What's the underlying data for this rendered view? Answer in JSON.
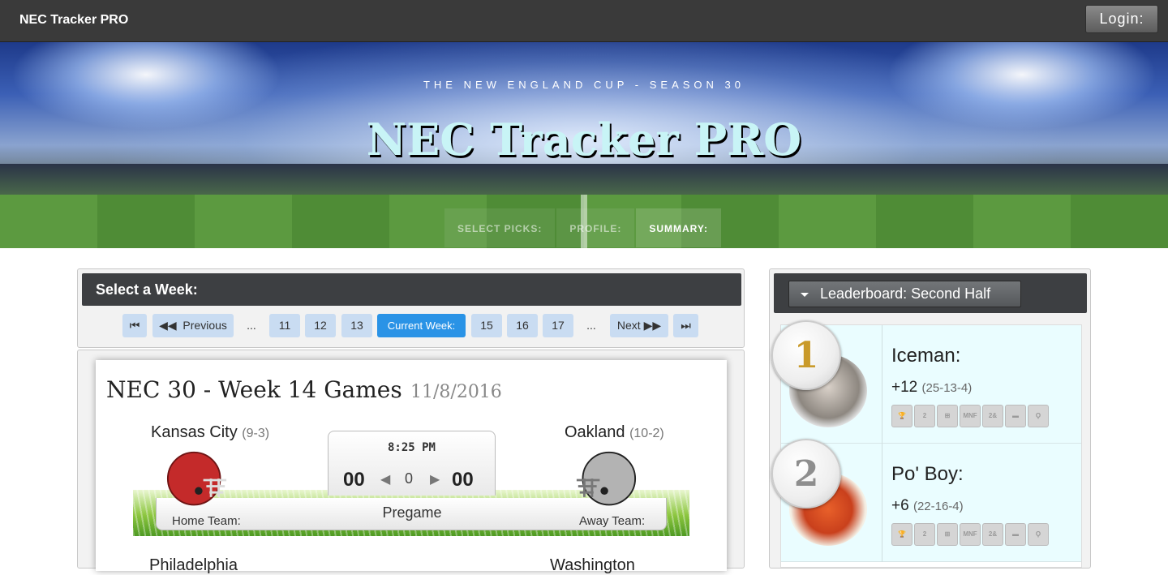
{
  "app": {
    "brand": "NEC Tracker PRO",
    "login_label": "Login:"
  },
  "hero": {
    "subtitle": "THE NEW ENGLAND CUP - SEASON 30",
    "title": "NEC Tracker PRO",
    "tabs": [
      "SELECT PICKS:",
      "PROFILE:",
      "SUMMARY:"
    ],
    "active_tab": "SUMMARY:"
  },
  "week_selector": {
    "heading": "Select a Week:",
    "first_icon": "first-page-icon",
    "previous_label": "Previous",
    "ellipsis": "...",
    "weeks_before": [
      "11",
      "12",
      "13"
    ],
    "current_label": "Current Week:",
    "weeks_after": [
      "15",
      "16",
      "17"
    ],
    "next_label": "Next",
    "last_icon": "last-page-icon"
  },
  "games": {
    "title": "NEC 30 - Week 14 Games",
    "date": "11/8/2016",
    "game": {
      "home_team": "Kansas City",
      "home_record": "(9-3)",
      "away_team": "Oakland",
      "away_record": "(10-2)",
      "time": "8:25 PM",
      "home_score": "00",
      "away_score": "00",
      "spread": "0",
      "status": "Pregame",
      "home_label": "Home Team:",
      "away_label": "Away Team:",
      "home_color": "#c42a2a",
      "away_color": "#a9a9a9"
    },
    "next_game": {
      "home_team": "Philadelphia",
      "away_team": "Washington"
    }
  },
  "leaderboard": {
    "dropdown_label": "Leaderboard: Second Half",
    "entries": [
      {
        "rank": "1",
        "name": "Iceman:",
        "points": "+12",
        "record": "(25-13-4)"
      },
      {
        "rank": "2",
        "name": "Po' Boy:",
        "points": "+6",
        "record": "(22-16-4)"
      }
    ],
    "badge_labels": [
      "trophy-icon",
      "trophy-2-icon",
      "bracket-icon",
      "MNF TNT",
      "2& OUT",
      "money-icon",
      "trophy-small-icon"
    ]
  },
  "colors": {
    "topbar": "#3a3a3a",
    "panel_header": "#3d3f42",
    "pager_button": "#c9dcf2",
    "pager_active": "#2a93e6",
    "leader_row": "#eafdff"
  }
}
